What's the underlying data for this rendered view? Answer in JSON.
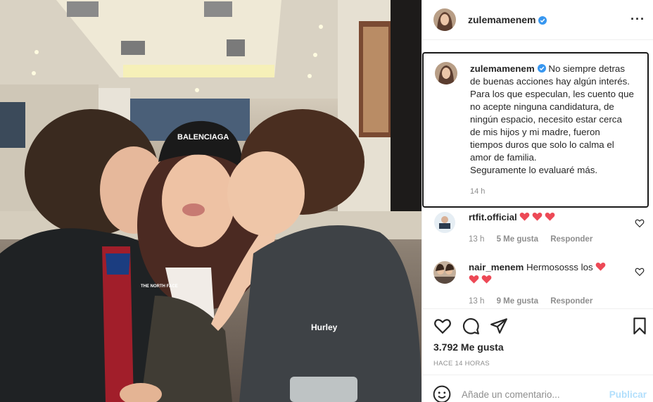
{
  "post": {
    "author": "zulemamenem",
    "photo_texts": {
      "cap_text": "BALENCIAGA",
      "jacket_brand": "THE NORTH FACE",
      "shirt_brand": "Hurley"
    }
  },
  "caption": {
    "username": "zulemamenem",
    "lines": [
      "No siempre detras",
      "de buenas acciones hay algún interés.",
      "Para los que especulan, les cuento que",
      "no acepte ninguna candidatura, de",
      "ningún espacio, necesito estar cerca",
      "de mis hijos y mi madre, fueron",
      "tiempos duros que solo lo calma el",
      "amor de familia.",
      "Seguramente lo evaluaré más."
    ],
    "time": "14 h"
  },
  "comments": [
    {
      "username": "rtfit.official",
      "text": "",
      "hearts": 3,
      "time": "13 h",
      "likes": "5 Me gusta",
      "reply": "Responder"
    },
    {
      "username": "nair_menem",
      "text": "Hermososss los",
      "hearts_inline": 1,
      "hearts_line2": 2,
      "time": "13 h",
      "likes": "9 Me gusta",
      "reply": "Responder"
    }
  ],
  "stats": {
    "likes": "3.792 Me gusta",
    "ago": "HACE 14 HORAS"
  },
  "composer": {
    "placeholder": "Añade un comentario...",
    "post_label": "Publicar"
  },
  "icons": [
    "more-options-icon",
    "verified-badge-icon",
    "heart-icon",
    "comment-icon",
    "share-icon",
    "bookmark-icon",
    "emoji-icon"
  ],
  "colors": {
    "verified": "#3897f0",
    "heart_red": "#ed4956",
    "meta_gray": "#8e8e8e",
    "publish_disabled": "#b2dffc"
  }
}
